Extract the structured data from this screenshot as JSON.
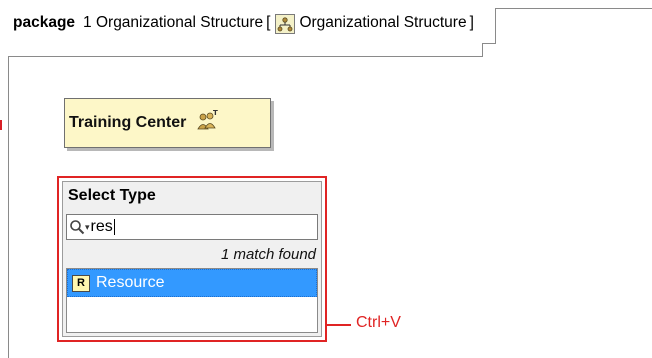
{
  "frame": {
    "keyword": "package",
    "name": "1 Organizational Structure",
    "open_bracket": "[",
    "diagram_name": "Organizational Structure",
    "close_bracket": "]",
    "diagram_icon": "organization-diagram-icon"
  },
  "element": {
    "name": "Training Center",
    "icon": "organization-unit-icon",
    "fill_color": "#fdf7c8"
  },
  "popup": {
    "title": "Select Type",
    "search_value": "res",
    "search_icon": "search-icon",
    "match_text": "1 match found",
    "results": [
      {
        "badge": "R",
        "label": "Resource",
        "selected": true
      }
    ],
    "selection_color": "#3399ff"
  },
  "callout": {
    "text": "Ctrl+V",
    "color": "#e02424"
  }
}
